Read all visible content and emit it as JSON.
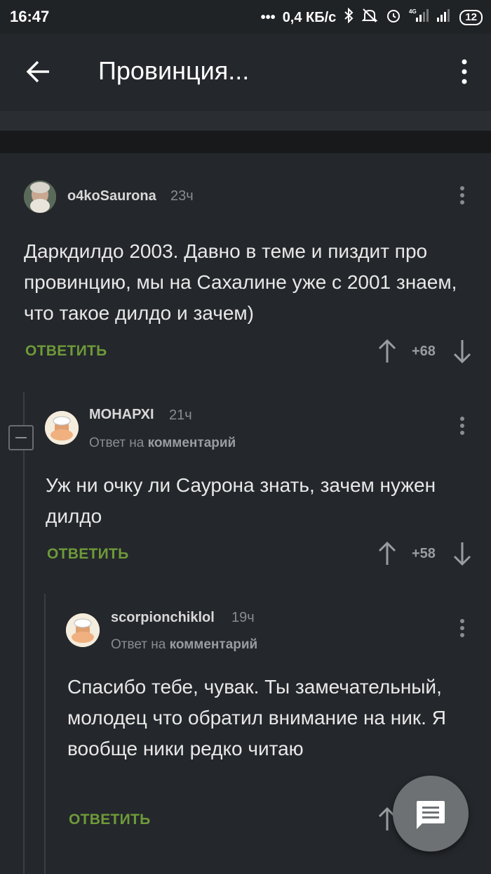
{
  "status_bar": {
    "time": "16:47",
    "network_speed": "0,4 КБ/с",
    "battery": "12",
    "icons": [
      "bluetooth-icon",
      "mute-icon",
      "alarm-icon",
      "signal-4g-icon",
      "signal-icon",
      "battery-icon"
    ]
  },
  "toolbar": {
    "title": "Провинция...",
    "back_icon": "arrow-left-icon",
    "menu_icon": "more-vertical-icon"
  },
  "comments": [
    {
      "username": "o4koSaurona",
      "time": "23ч",
      "text": "Даркдилдо 2003. Давно в теме и пиздит про провинцию, мы на Сахалине уже с 2001 знаем, что такое дилдо и зачем)",
      "reply_label": "ОТВЕТИТЬ",
      "score": "+68"
    },
    {
      "username": "МОНАРХI",
      "time": "21ч",
      "reply_prefix": "Ответ на",
      "reply_target": "комментарий",
      "text": "Уж ни очку ли Саурона знать, зачем нужен дилдо",
      "reply_label": "ОТВЕТИТЬ",
      "score": "+58"
    },
    {
      "username": "scorpionchiklol",
      "time": "19ч",
      "reply_prefix": "Ответ на",
      "reply_target": "комментарий",
      "text": "Спасибо тебе, чувак. Ты замечательный, молодец что обратил внимание на ник. Я вообще ники редко читаю",
      "reply_label": "ОТВЕТИТЬ"
    }
  ],
  "fab_icon": "comment-icon",
  "colors": {
    "background": "#24272b",
    "accent_green": "#6e9a3a",
    "text_muted": "#8a8d90"
  }
}
